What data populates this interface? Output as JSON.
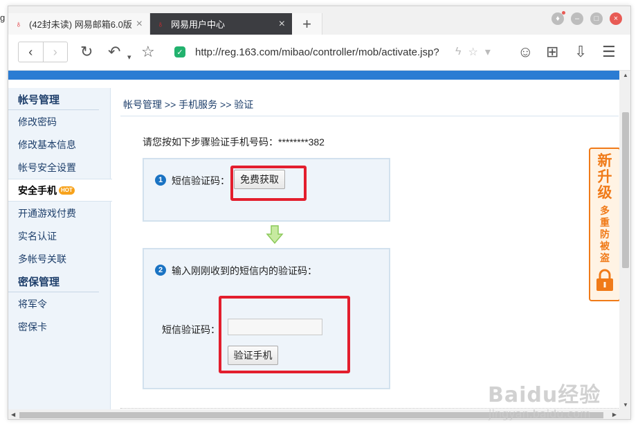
{
  "clip_left_text": "g",
  "tabs": [
    {
      "label": "(42封未读) 网易邮箱6.0版",
      "favicon": "163-icon"
    },
    {
      "label": "网易用户中心",
      "favicon": "163-icon"
    }
  ],
  "new_tab": "+",
  "address": {
    "url": "http://reg.163.com/mibao/controller/mob/activate.jsp?"
  },
  "sidebar": {
    "groups": [
      {
        "title": "帐号管理",
        "items": [
          "修改密码",
          "修改基本信息",
          "帐号安全设置",
          "安全手机",
          "开通游戏付费",
          "实名认证",
          "多帐号关联"
        ]
      },
      {
        "title": "密保管理",
        "items": [
          "将军令",
          "密保卡"
        ]
      }
    ],
    "hot_badge": "HOT"
  },
  "breadcrumb": "帐号管理 >> 手机服务 >> 验证",
  "intro": "请您按如下步骤验证手机号码：********382",
  "step1": {
    "num": "1",
    "label": "短信验证码：",
    "button": "免费获取"
  },
  "step2": {
    "num": "2",
    "label": "输入刚刚收到的短信内的验证码：",
    "field_label": "短信验证码：",
    "field_value": "",
    "button": "验证手机"
  },
  "promo": {
    "big": [
      "新",
      "升",
      "级"
    ],
    "small": [
      "多",
      "重",
      "防",
      "被",
      "盗"
    ]
  },
  "watermark": {
    "logo": "Baidu经验",
    "site": "jingyan.baidu.com"
  },
  "colors": {
    "accent": "#2b7cd3",
    "highlight": "#e31e2d",
    "promo": "#f07a18"
  }
}
